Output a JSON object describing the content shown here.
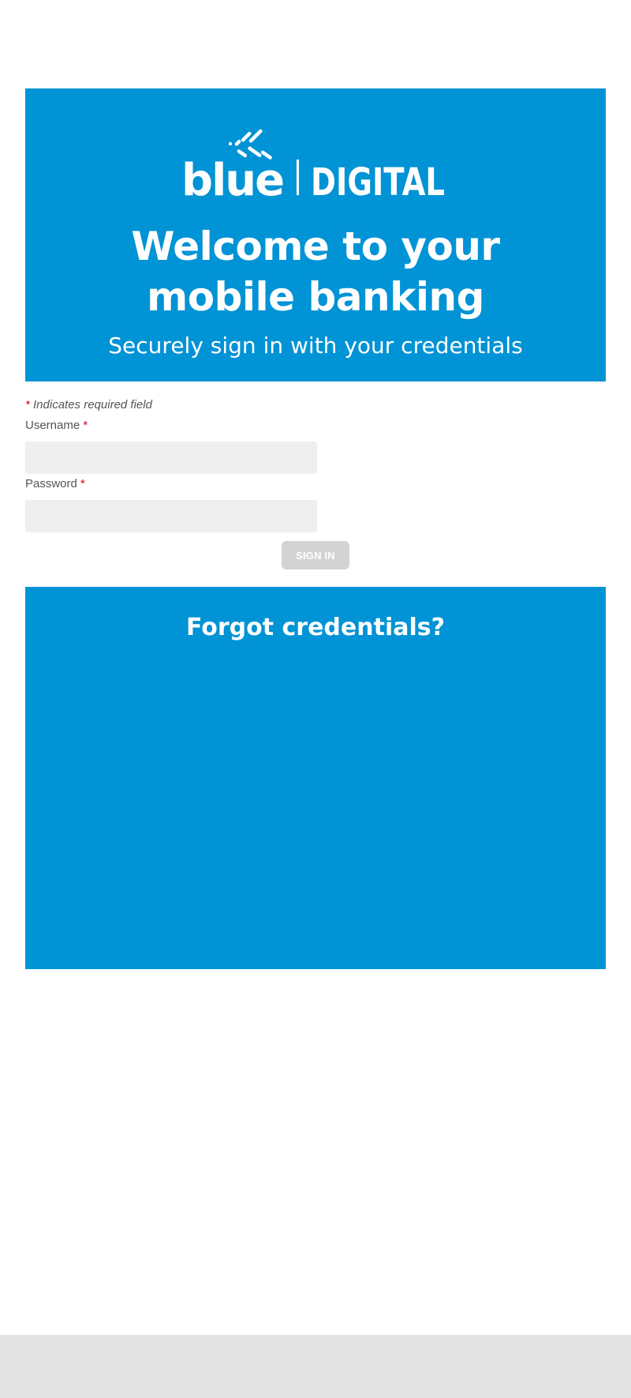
{
  "brand": {
    "logo_text": "blue | DIGITAL",
    "logo_icon": "blue-digital-logo"
  },
  "hero": {
    "title_line1": "Welcome to your",
    "title_line2": "mobile banking",
    "subtitle": "Securely sign in with your credentials"
  },
  "form": {
    "required_marker": "*",
    "required_note": "Indicates required field",
    "username_label": "Username",
    "username_value": "",
    "password_label": "Password",
    "password_value": "",
    "signin_label": "SIGN IN"
  },
  "forgot": {
    "title": "Forgot credentials?"
  },
  "colors": {
    "brand_blue": "#0093d5",
    "required_red": "#d9001b",
    "input_bg": "#efefef",
    "button_disabled": "#d3d3d3",
    "footer_bg": "#e4e4e4"
  }
}
